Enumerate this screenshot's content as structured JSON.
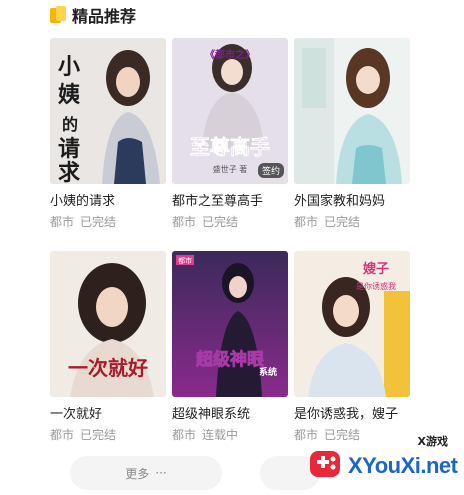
{
  "section": {
    "title": "精品推荐"
  },
  "books": [
    {
      "title": "小姨的请求",
      "category": "都市",
      "status": "已完结",
      "cover_text": "小姨的请求"
    },
    {
      "title": "都市之至尊高手",
      "category": "都市",
      "status": "已完结",
      "cover_text_top": "《都市之》",
      "cover_text_main": "至尊高手",
      "cover_author": "盛世子 著",
      "cover_tag": "签约"
    },
    {
      "title": "外国家教和妈妈",
      "category": "都市",
      "status": "已完结"
    },
    {
      "title": "一次就好",
      "category": "都市",
      "status": "已完结",
      "cover_text": "一次就好"
    },
    {
      "title": "超级神眼系统",
      "category": "都市",
      "status": "连载中",
      "cover_text": "超级神眼系统",
      "cover_badge": "都市"
    },
    {
      "title": "是你诱惑我，嫂子",
      "category": "都市",
      "status": "已完结",
      "cover_text": "嫂子 是你诱惑我"
    }
  ],
  "footer": {
    "more_label": "更多",
    "dots": "···"
  },
  "watermark": {
    "brand": "XYouXi.net",
    "small": "X游戏"
  },
  "colors": {
    "accent": "#f7b400",
    "meta": "#9a9a9a",
    "brand": "#1a66c9"
  }
}
